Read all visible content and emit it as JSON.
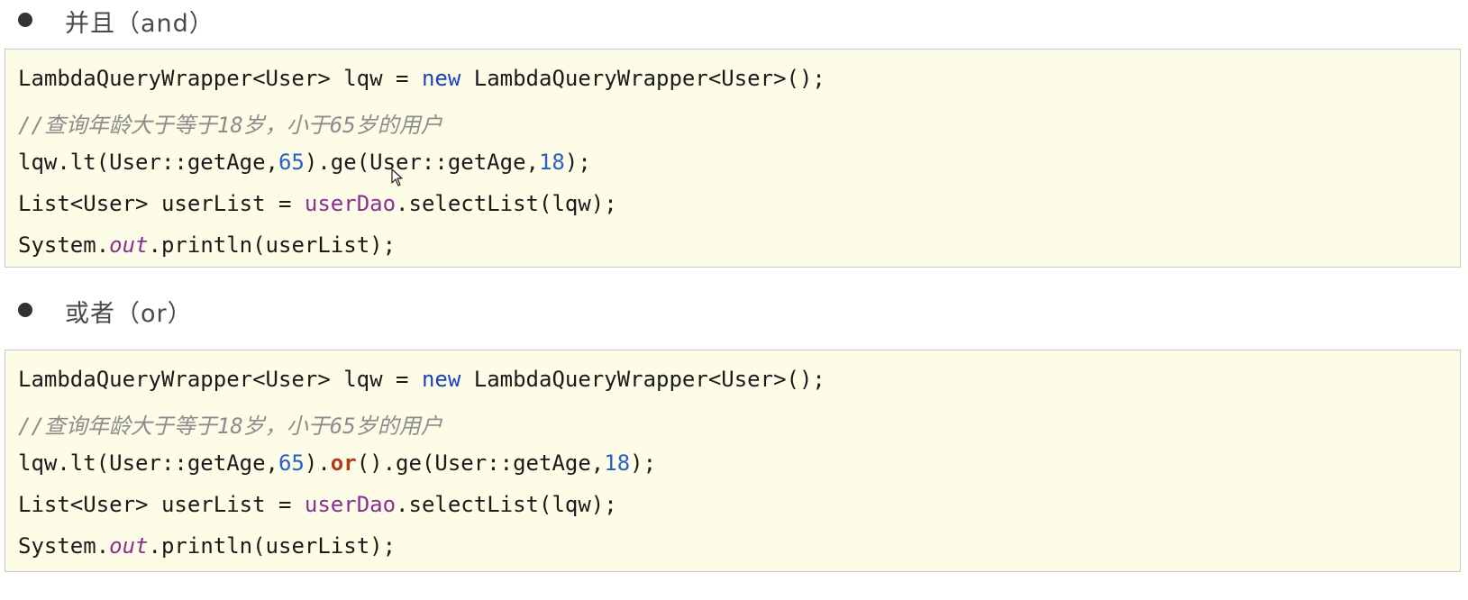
{
  "section_and": {
    "heading": "并且（and）",
    "code": {
      "line1": {
        "a": "LambdaQueryWrapper<User> lqw = ",
        "kw": "new",
        "b": " LambdaQueryWrapper<User>();"
      },
      "line2": {
        "comment": "//查询年龄大于等于18岁，小于65岁的用户"
      },
      "line3": {
        "a": "lqw.lt(User::getAge,",
        "n1": "65",
        "b": ").ge(User::getAge,",
        "n2": "18",
        "c": ");"
      },
      "line4": {
        "a": "List<User> userList = ",
        "field": "userDao",
        "b": ".selectList(lqw);"
      },
      "line5": {
        "a": "System.",
        "field": "out",
        "b": ".println(userList);"
      }
    }
  },
  "section_or": {
    "heading": "或者（or）",
    "code": {
      "line1": {
        "a": "LambdaQueryWrapper<User> lqw = ",
        "kw": "new",
        "b": " LambdaQueryWrapper<User>();"
      },
      "line2": {
        "comment": "//查询年龄大于等于18岁，小于65岁的用户"
      },
      "line3": {
        "a": "lqw.lt(User::getAge,",
        "n1": "65",
        "b": ").",
        "or": "or",
        "c": "().ge(User::getAge,",
        "n2": "18",
        "d": ");"
      },
      "line4": {
        "a": "List<User> userList = ",
        "field": "userDao",
        "b": ".selectList(lqw);"
      },
      "line5": {
        "a": "System.",
        "field": "out",
        "b": ".println(userList);"
      }
    }
  },
  "colors": {
    "code_background": "#fdfce6",
    "keyword": "#1f3fbd",
    "number": "#2860c8",
    "field": "#8a2f96",
    "or_method": "#b03a1e",
    "comment": "#8c8c8c"
  },
  "icons": {
    "bullet": "bullet-dot",
    "cursor": "mouse-pointer-icon"
  }
}
